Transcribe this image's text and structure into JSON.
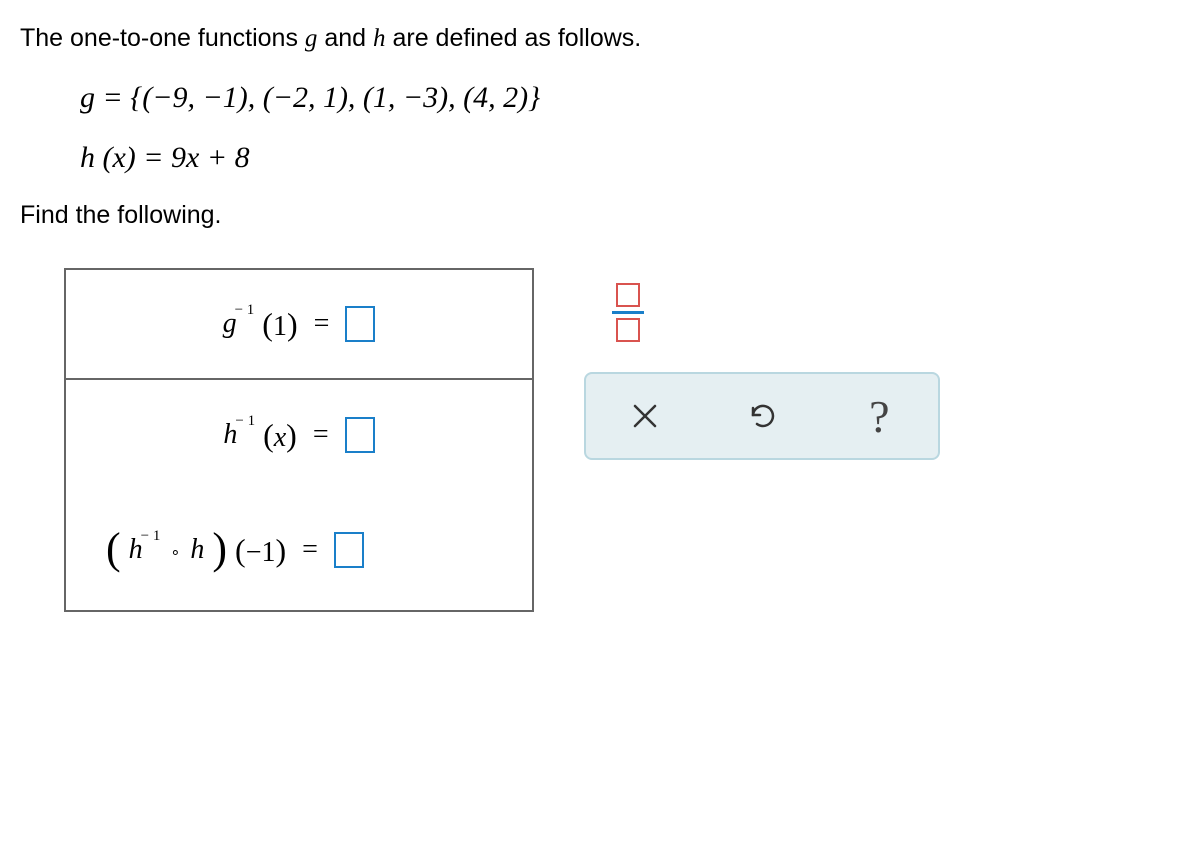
{
  "intro": {
    "prefix": "The one-to-one functions ",
    "g": "g",
    "mid": " and ",
    "h": "h",
    "suffix": " are defined as follows."
  },
  "g_def": "g = {(−9,  −1),  (−2,  1),  (1,  −3),  (4,  2)}",
  "h_def": "h (x) = 9x + 8",
  "find_text": "Find the following.",
  "rows": {
    "r1": {
      "base": "g",
      "sup": "− 1",
      "arg": "1",
      "eq": "="
    },
    "r2": {
      "base": "h",
      "sup": "− 1",
      "arg": "x",
      "eq": "="
    },
    "r3": {
      "base1": "h",
      "sup1": "− 1",
      "comp": "∘",
      "base2": "h",
      "arg": "−1",
      "eq": "="
    }
  },
  "tools": {
    "fraction": "fraction",
    "clear": "clear",
    "reset": "reset",
    "help": "?"
  }
}
